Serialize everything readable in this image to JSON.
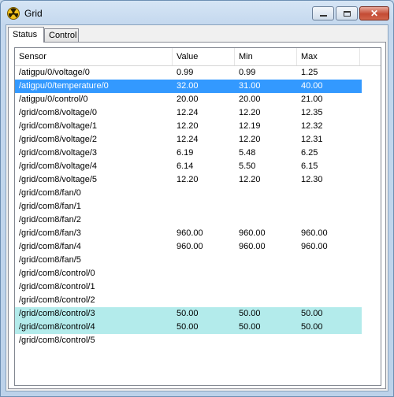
{
  "window": {
    "title": "Grid"
  },
  "tabs": [
    {
      "label": "Status"
    },
    {
      "label": "Control"
    }
  ],
  "columns": [
    "Sensor",
    "Value",
    "Min",
    "Max"
  ],
  "rows": [
    {
      "sensor": "/atigpu/0/voltage/0",
      "value": "0.99",
      "min": "0.99",
      "max": "1.25",
      "state": ""
    },
    {
      "sensor": "/atigpu/0/temperature/0",
      "value": "32.00",
      "min": "31.00",
      "max": "40.00",
      "state": "selected"
    },
    {
      "sensor": "/atigpu/0/control/0",
      "value": "20.00",
      "min": "20.00",
      "max": "21.00",
      "state": ""
    },
    {
      "sensor": "/grid/com8/voltage/0",
      "value": "12.24",
      "min": "12.20",
      "max": "12.35",
      "state": ""
    },
    {
      "sensor": "/grid/com8/voltage/1",
      "value": "12.20",
      "min": "12.19",
      "max": "12.32",
      "state": ""
    },
    {
      "sensor": "/grid/com8/voltage/2",
      "value": "12.24",
      "min": "12.20",
      "max": "12.31",
      "state": ""
    },
    {
      "sensor": "/grid/com8/voltage/3",
      "value": "6.19",
      "min": "5.48",
      "max": "6.25",
      "state": ""
    },
    {
      "sensor": "/grid/com8/voltage/4",
      "value": "6.14",
      "min": "5.50",
      "max": "6.15",
      "state": ""
    },
    {
      "sensor": "/grid/com8/voltage/5",
      "value": "12.20",
      "min": "12.20",
      "max": "12.30",
      "state": ""
    },
    {
      "sensor": "/grid/com8/fan/0",
      "value": "",
      "min": "",
      "max": "",
      "state": ""
    },
    {
      "sensor": "/grid/com8/fan/1",
      "value": "",
      "min": "",
      "max": "",
      "state": ""
    },
    {
      "sensor": "/grid/com8/fan/2",
      "value": "",
      "min": "",
      "max": "",
      "state": ""
    },
    {
      "sensor": "/grid/com8/fan/3",
      "value": "960.00",
      "min": "960.00",
      "max": "960.00",
      "state": ""
    },
    {
      "sensor": "/grid/com8/fan/4",
      "value": "960.00",
      "min": "960.00",
      "max": "960.00",
      "state": ""
    },
    {
      "sensor": "/grid/com8/fan/5",
      "value": "",
      "min": "",
      "max": "",
      "state": ""
    },
    {
      "sensor": "/grid/com8/control/0",
      "value": "",
      "min": "",
      "max": "",
      "state": ""
    },
    {
      "sensor": "/grid/com8/control/1",
      "value": "",
      "min": "",
      "max": "",
      "state": ""
    },
    {
      "sensor": "/grid/com8/control/2",
      "value": "",
      "min": "",
      "max": "",
      "state": ""
    },
    {
      "sensor": "/grid/com8/control/3",
      "value": "50.00",
      "min": "50.00",
      "max": "50.00",
      "state": "highlighted"
    },
    {
      "sensor": "/grid/com8/control/4",
      "value": "50.00",
      "min": "50.00",
      "max": "50.00",
      "state": "highlighted"
    },
    {
      "sensor": "/grid/com8/control/5",
      "value": "",
      "min": "",
      "max": "",
      "state": ""
    }
  ],
  "colors": {
    "selected": "#3399ff",
    "highlighted": "#b3ebeb"
  }
}
